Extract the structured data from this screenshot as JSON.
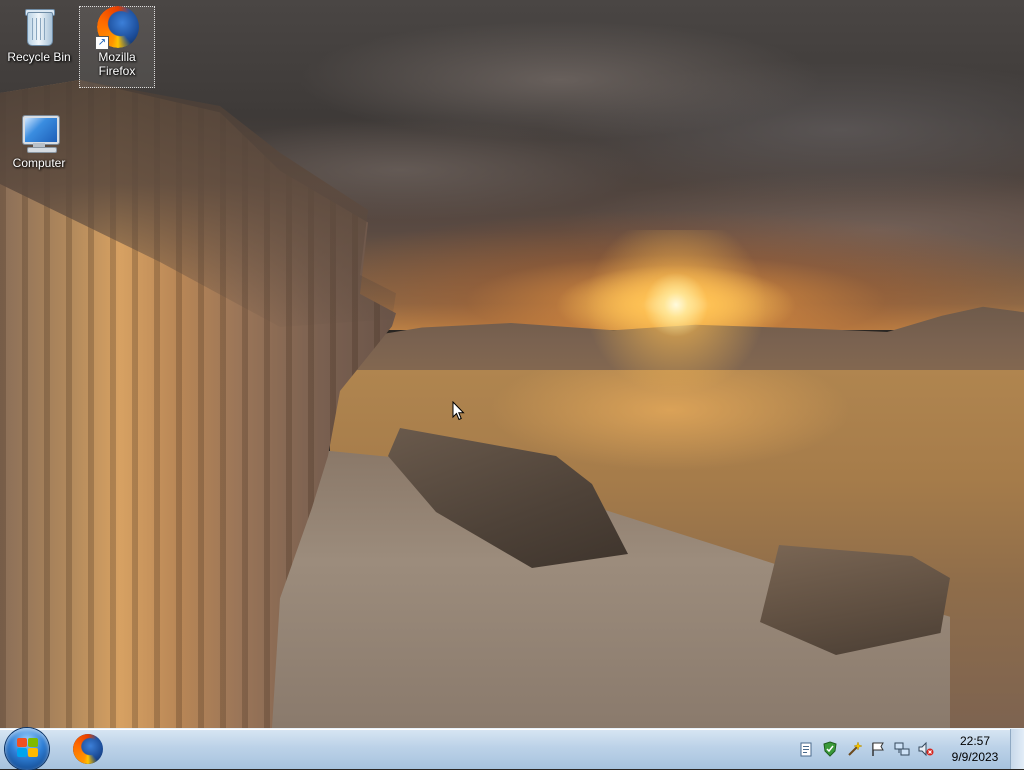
{
  "desktop": {
    "icons": [
      {
        "label": "Recycle Bin",
        "icon": "recycle-bin-icon"
      },
      {
        "label": "Mozilla Firefox",
        "icon": "firefox-icon",
        "selected": true,
        "shortcut": true
      },
      {
        "label": "Computer",
        "icon": "computer-icon"
      }
    ],
    "wallpaper": "sunset-canyon-landscape"
  },
  "taskbar": {
    "start_button": {
      "icon": "windows-start-orb-icon"
    },
    "pinned": [
      {
        "icon": "firefox-icon"
      }
    ],
    "tray": [
      {
        "icon": "clipboard-icon"
      },
      {
        "icon": "security-shield-icon"
      },
      {
        "icon": "wand-icon"
      },
      {
        "icon": "action-center-flag-icon"
      },
      {
        "icon": "network-icon"
      },
      {
        "icon": "volume-muted-icon"
      }
    ],
    "clock": {
      "time": "22:57",
      "date": "9/9/2023"
    }
  },
  "colors": {
    "taskbar_top": "#d8e6f3",
    "taskbar_bottom": "#a7c3de",
    "start_orb": "#2f7fd6"
  }
}
